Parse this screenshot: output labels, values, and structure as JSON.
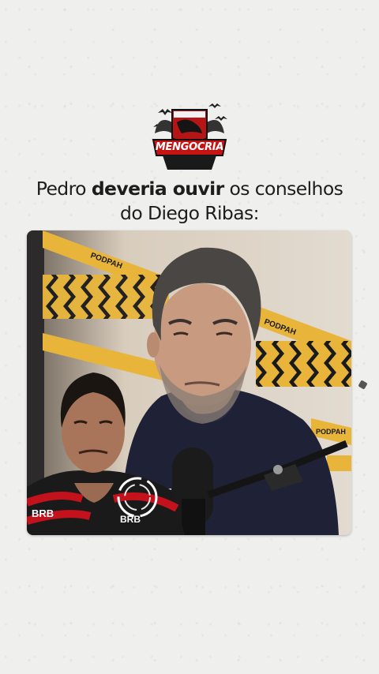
{
  "brand": {
    "logo_text": "MENGOCRIA",
    "accent": "#d11a1a"
  },
  "headline": {
    "regular_1": "Pedro ",
    "bold": "deveria ouvir",
    "regular_2": " os conselhos",
    "line_2": "do Diego Ribas:"
  },
  "video": {
    "tape_text": "PODPAH",
    "sponsor": "BRB",
    "kind": "podcast-clip"
  },
  "colors": {
    "background": "#efefed",
    "text": "#1d1d1d",
    "tape": "#e8b53a"
  }
}
